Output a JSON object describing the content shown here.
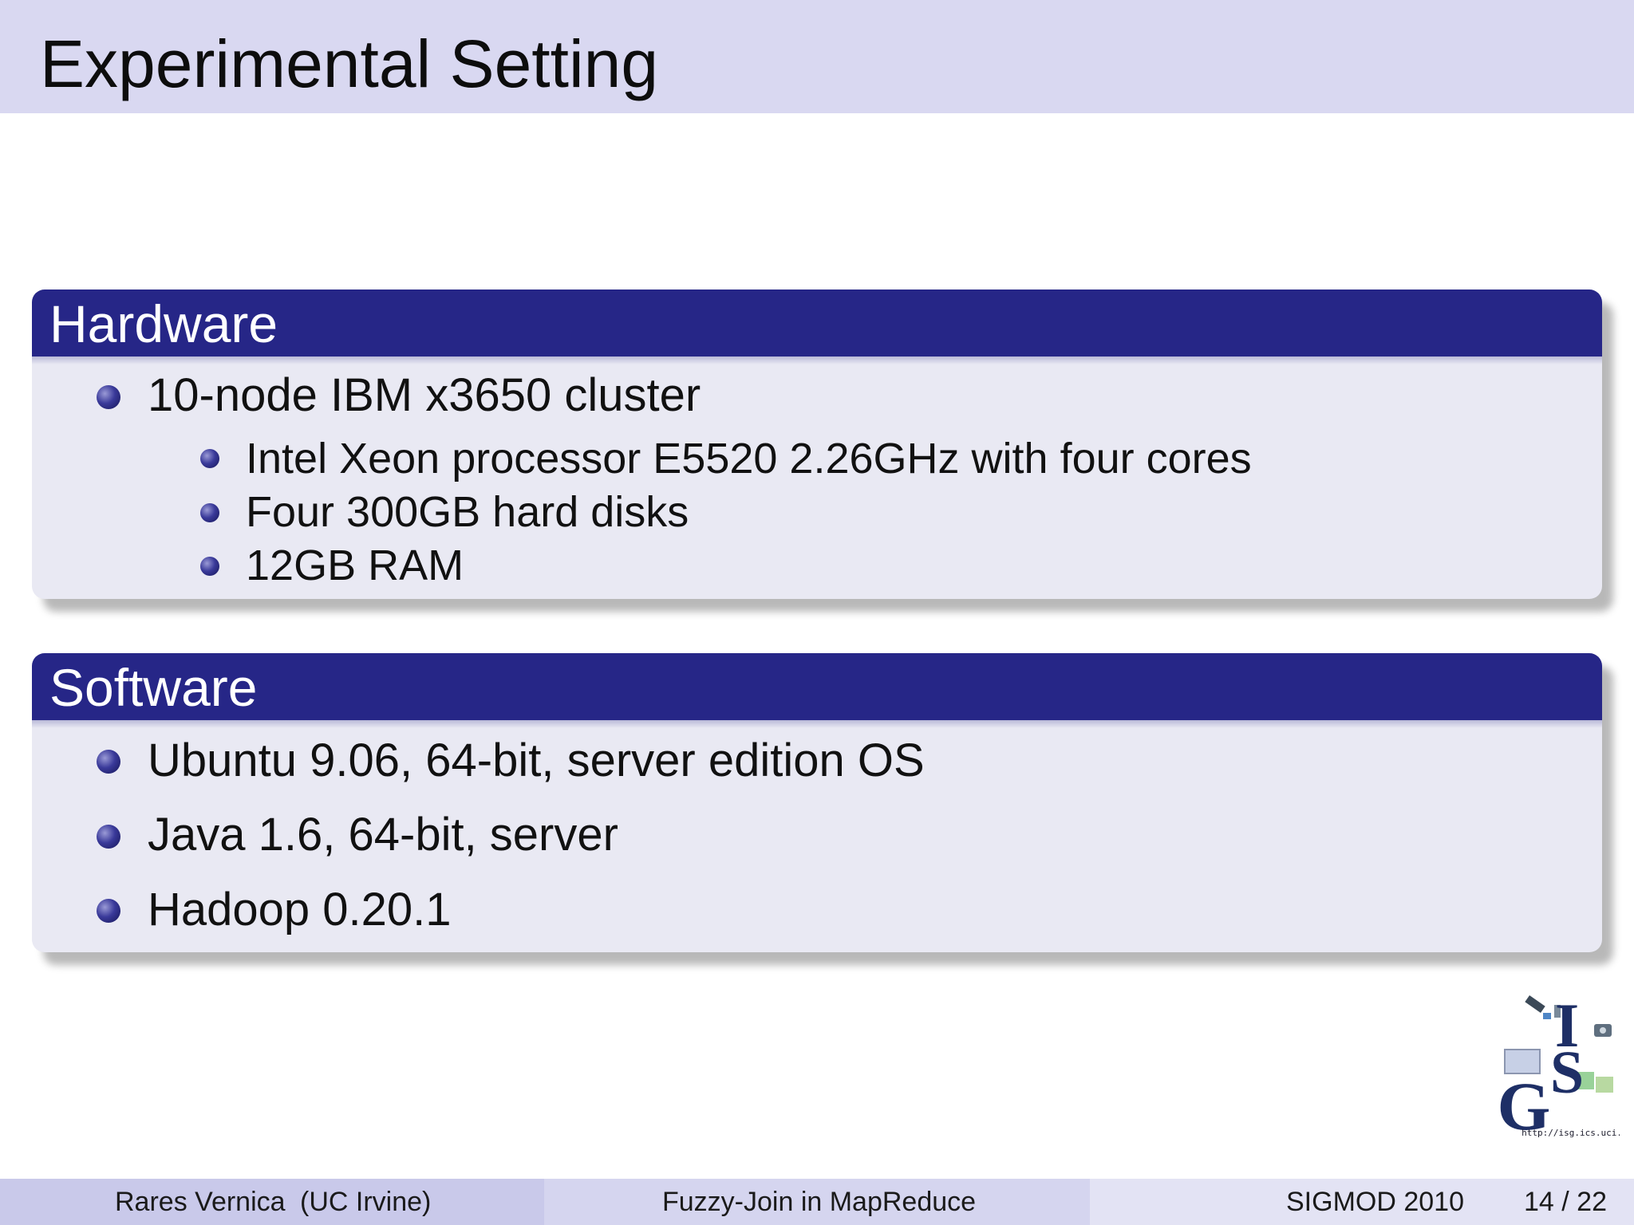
{
  "slide": {
    "title": "Experimental Setting"
  },
  "hardware": {
    "title": "Hardware",
    "item": "10-node IBM x3650 cluster",
    "subitems": [
      "Intel Xeon processor E5520 2.26GHz with four cores",
      "Four 300GB hard disks",
      "12GB RAM"
    ]
  },
  "software": {
    "title": "Software",
    "items": [
      "Ubuntu 9.06, 64-bit, server edition OS",
      "Java 1.6, 64-bit, server",
      "Hadoop 0.20.1"
    ]
  },
  "logo": {
    "letters": "ISG",
    "url": "http://isg.ics.uci.edu"
  },
  "footer": {
    "author": "Rares Vernica",
    "affiliation": "(UC Irvine)",
    "talk": "Fuzzy-Join in MapReduce",
    "venue": "SIGMOD 2010",
    "page": "14 / 22"
  },
  "colors": {
    "title_bar": "#d9d8f1",
    "block_header": "#262687",
    "block_body": "#e9e9f3"
  }
}
